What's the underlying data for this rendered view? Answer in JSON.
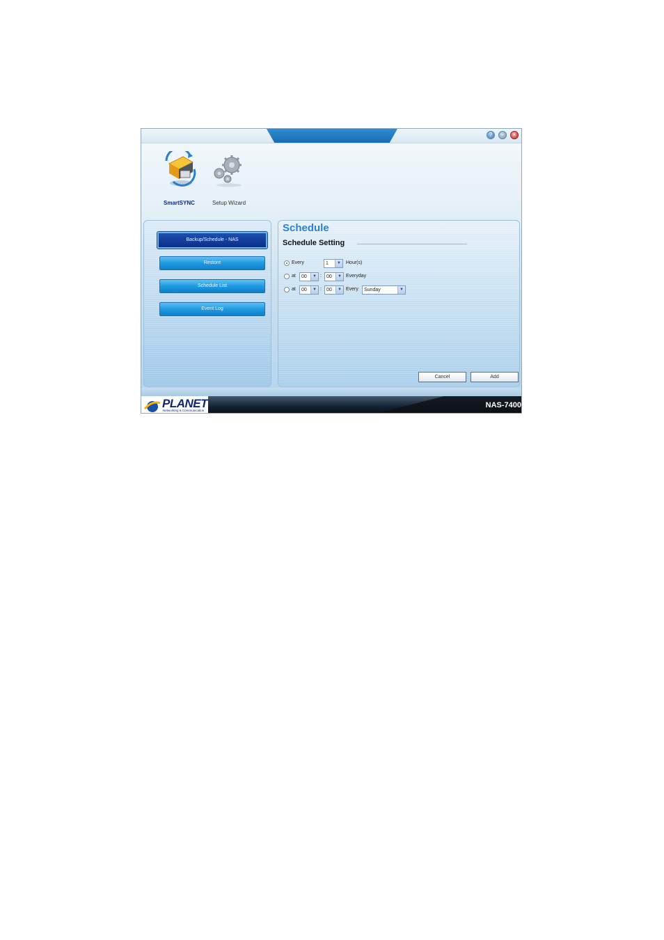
{
  "titlebar": {
    "help_icon": "question-icon",
    "minimize_icon": "minimize-icon",
    "close_icon": "close-icon",
    "help_glyph": "?",
    "minimize_glyph": "–",
    "close_glyph": "×"
  },
  "apps": [
    {
      "label": "SmartSYNC",
      "icon": "smartsync-icon"
    },
    {
      "label": "Setup Wizard",
      "icon": "gears-icon"
    }
  ],
  "sidebar": {
    "items": [
      {
        "label": "Backup/Schedule - NAS",
        "active": true
      },
      {
        "label": "Restore",
        "active": false
      },
      {
        "label": "Schedule List",
        "active": false
      },
      {
        "label": "Event Log",
        "active": false
      }
    ]
  },
  "main": {
    "title": "Schedule",
    "section": "Schedule Setting",
    "rows": [
      {
        "selected": true,
        "prefix": "Every",
        "hour_value": "1",
        "suffix": "Hour(s)"
      },
      {
        "selected": false,
        "prefix": "at",
        "hour": "00",
        "sep": ":",
        "minute": "00",
        "suffix": "Everyday"
      },
      {
        "selected": false,
        "prefix": "at",
        "hour": "00",
        "sep": ":",
        "minute": "00",
        "suffix": "Every",
        "day": "Sunday"
      }
    ],
    "buttons": {
      "cancel": "Cancel",
      "add": "Add"
    }
  },
  "footer": {
    "brand": "PLANET",
    "tagline": "Networking & Communication",
    "model": "NAS-7400"
  },
  "colors": {
    "accent": "#2f7fd6",
    "nav_button": "#1f9ae0",
    "nav_active": "#0b2f86",
    "footer_bg": "#0a0f14"
  }
}
